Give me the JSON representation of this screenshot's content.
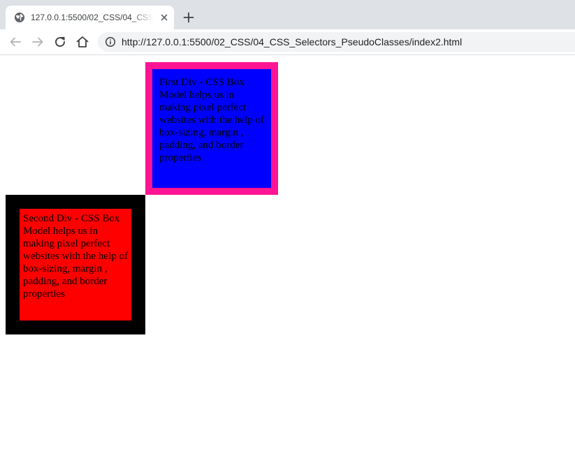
{
  "browser": {
    "tab": {
      "title": "127.0.0.1:5500/02_CSS/04_CSS_Selectors_PseudoClasses/index2.html",
      "favicon": "globe-icon",
      "close_icon": "close-icon"
    },
    "new_tab_icon": "plus-icon",
    "toolbar": {
      "back_icon": "arrow-left-icon",
      "forward_icon": "arrow-right-icon",
      "reload_icon": "reload-icon",
      "home_icon": "home-icon",
      "info_icon": "info-icon"
    },
    "address_bar": {
      "url": "http://127.0.0.1:5500/02_CSS/04_CSS_Selectors_PseudoClasses/index2.html"
    }
  },
  "page": {
    "first_div": {
      "text": "First Div - CSS Box Model helps us in making pixel perfect websites with the help of box-sizing, margin , padding, and border properties",
      "background": "#0000ff",
      "border_color": "#ff1493"
    },
    "second_div": {
      "text": "Second Div - CSS Box Model helps us in making pixel perfect websites with the help of box-sizing, margin , padding, and border properties",
      "background": "#ff0000",
      "border_color": "#000000"
    }
  }
}
